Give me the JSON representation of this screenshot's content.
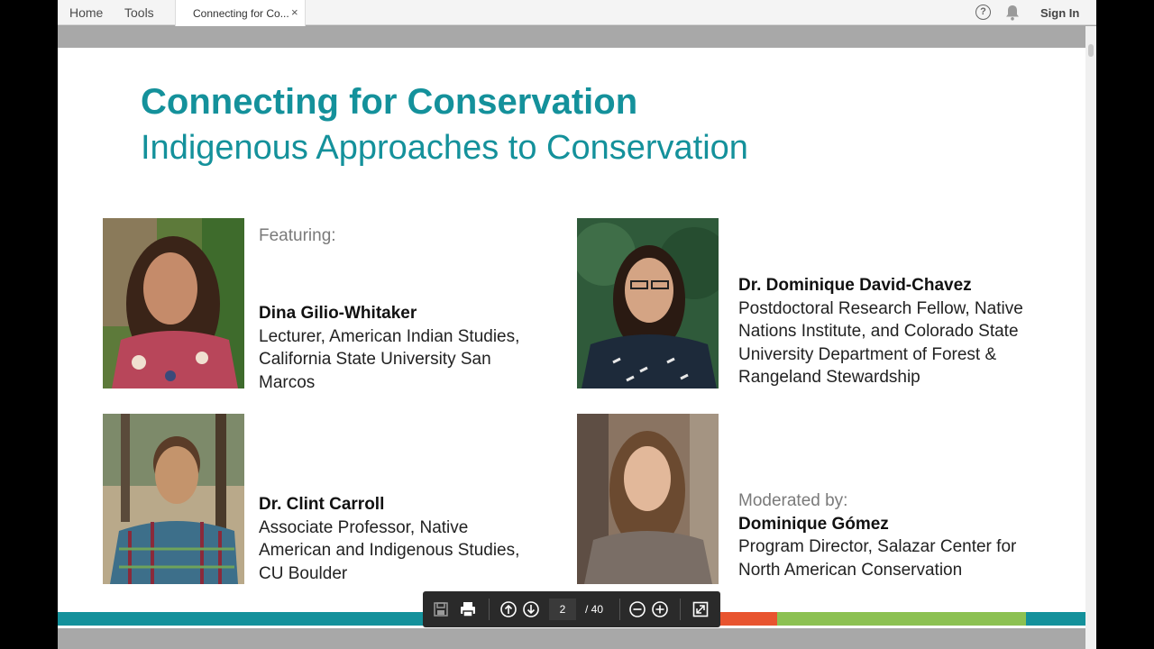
{
  "topbar": {
    "home": "Home",
    "tools": "Tools",
    "tab_title": "Connecting for Co...",
    "tab_close": "×",
    "help": "?",
    "sign_in": "Sign In"
  },
  "slide": {
    "title": "Connecting for Conservation",
    "subtitle": "Indigenous Approaches to Conservation",
    "featuring_label": "Featuring:",
    "moderated_label": "Moderated by:",
    "speakers": [
      {
        "name": "Dina Gilio-Whitaker",
        "role_lines": [
          "Lecturer, American Indian Studies,",
          "California State University San",
          "Marcos"
        ]
      },
      {
        "name": "Dr. Dominique David-Chavez",
        "role_lines": [
          "Postdoctoral Research Fellow, Native",
          "Nations Institute, and Colorado State",
          "University Department of Forest &",
          "Rangeland Stewardship"
        ]
      },
      {
        "name": "Dr. Clint Carroll",
        "role_lines": [
          "Associate Professor, Native",
          "American and Indigenous Studies,",
          "CU Boulder"
        ]
      },
      {
        "name": "Dominique Gómez",
        "role_lines": [
          "Program Director, Salazar Center for",
          "North American Conservation"
        ]
      }
    ],
    "stripe_colors": [
      "#14919b",
      "#e8542f",
      "#8cc152",
      "#14919b"
    ]
  },
  "toolbar": {
    "icons": [
      "save-icon",
      "print-icon",
      "page-up-icon",
      "page-down-icon",
      "zoom-out-icon",
      "zoom-in-icon",
      "fit-page-icon"
    ],
    "current_page": "2",
    "total_pages": "/ 40"
  },
  "colors": {
    "accent": "#14919b",
    "toolbar_bg": "#2a2a2a"
  }
}
